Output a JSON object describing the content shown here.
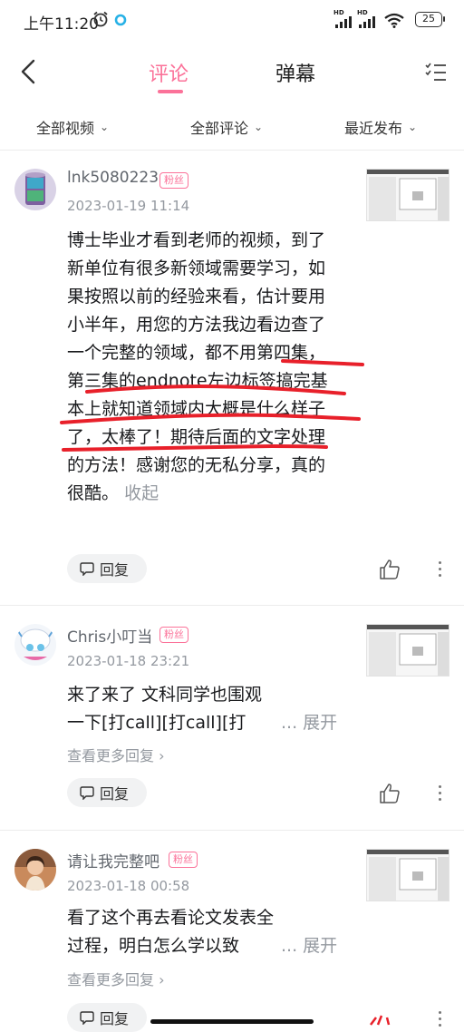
{
  "status_bar": {
    "time": "上午11:20",
    "hd1": "HD",
    "hd2": "HD",
    "battery": "25"
  },
  "nav": {
    "tabs": [
      {
        "label": "评论",
        "active": true
      },
      {
        "label": "弹幕",
        "active": false
      }
    ],
    "icons": [
      "back-icon",
      "list-settings-icon"
    ]
  },
  "filters": [
    {
      "label": "全部视频"
    },
    {
      "label": "全部评论"
    },
    {
      "label": "最近发布"
    }
  ],
  "colors": {
    "accent": "#fb7299",
    "annotation": "#e8202a",
    "secondary_text": "#9499a0"
  },
  "comments": [
    {
      "username": "lnk5080223",
      "badge": "粉丝",
      "date": "2023-01-19 11:14",
      "text": "博士毕业才看到老师的视频，到了新单位有很多新领域需要学习，如果按照以前的经验来看，估计要用小半年，用您的方法我边看边查了一个完整的领域，都不用第四集，第三集的endnote左边标签搞完基本上就知道领域内大概是什么样子了，太棒了！期待后面的文字处理的方法！感谢您的无私分享，真的很酷。",
      "collapse": "收起",
      "reply_label": "回复"
    },
    {
      "username": "Chris小叮当",
      "badge": "粉丝",
      "date": "2023-01-18 23:21",
      "text": "来了来了 文科同学也围观一下[打call][打call][打",
      "expand": "... 展开",
      "more_replies": "查看更多回复",
      "reply_label": "回复"
    },
    {
      "username": "请让我完整吧",
      "badge": "粉丝",
      "date": "2023-01-18 00:58",
      "text": "看了这个再去看论文发表全过程，明白怎么学以致",
      "expand": "... 展开",
      "more_replies": "查看更多回复",
      "reply_label": "回复"
    }
  ]
}
